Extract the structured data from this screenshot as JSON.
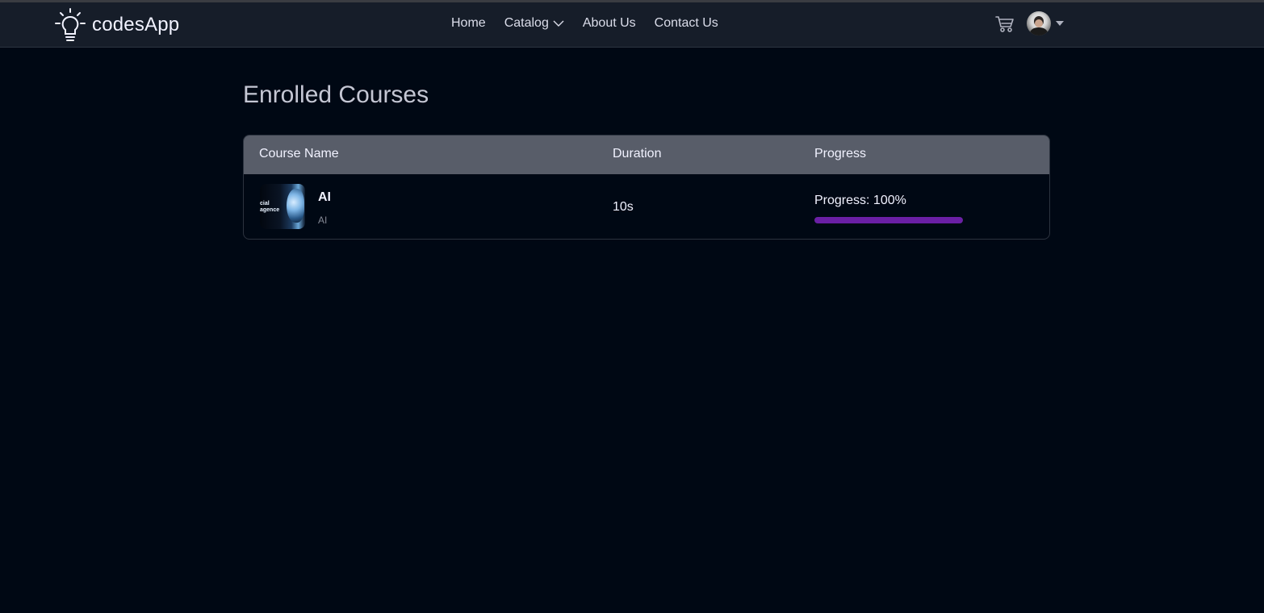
{
  "brand": {
    "name": "codesApp"
  },
  "nav": {
    "links": [
      "Home",
      "Catalog",
      "About Us",
      "Contact Us"
    ]
  },
  "header_icons": {
    "cart": "cart-icon",
    "profile_caret": "caret-down-icon"
  },
  "page": {
    "title": "Enrolled Courses"
  },
  "table": {
    "headers": [
      "Course Name",
      "Duration",
      "Progress"
    ],
    "rows": [
      {
        "name": "AI",
        "description": "AI",
        "duration": "10s",
        "progress_label": "Progress: 100%",
        "progress_percent": 100,
        "thumbnail_text": [
          "cial",
          "agence"
        ]
      }
    ]
  },
  "colors": {
    "background": "#000814",
    "navbar": "#161d29",
    "table_header": "#585d69",
    "progress_fill": "#6a1fa5"
  }
}
